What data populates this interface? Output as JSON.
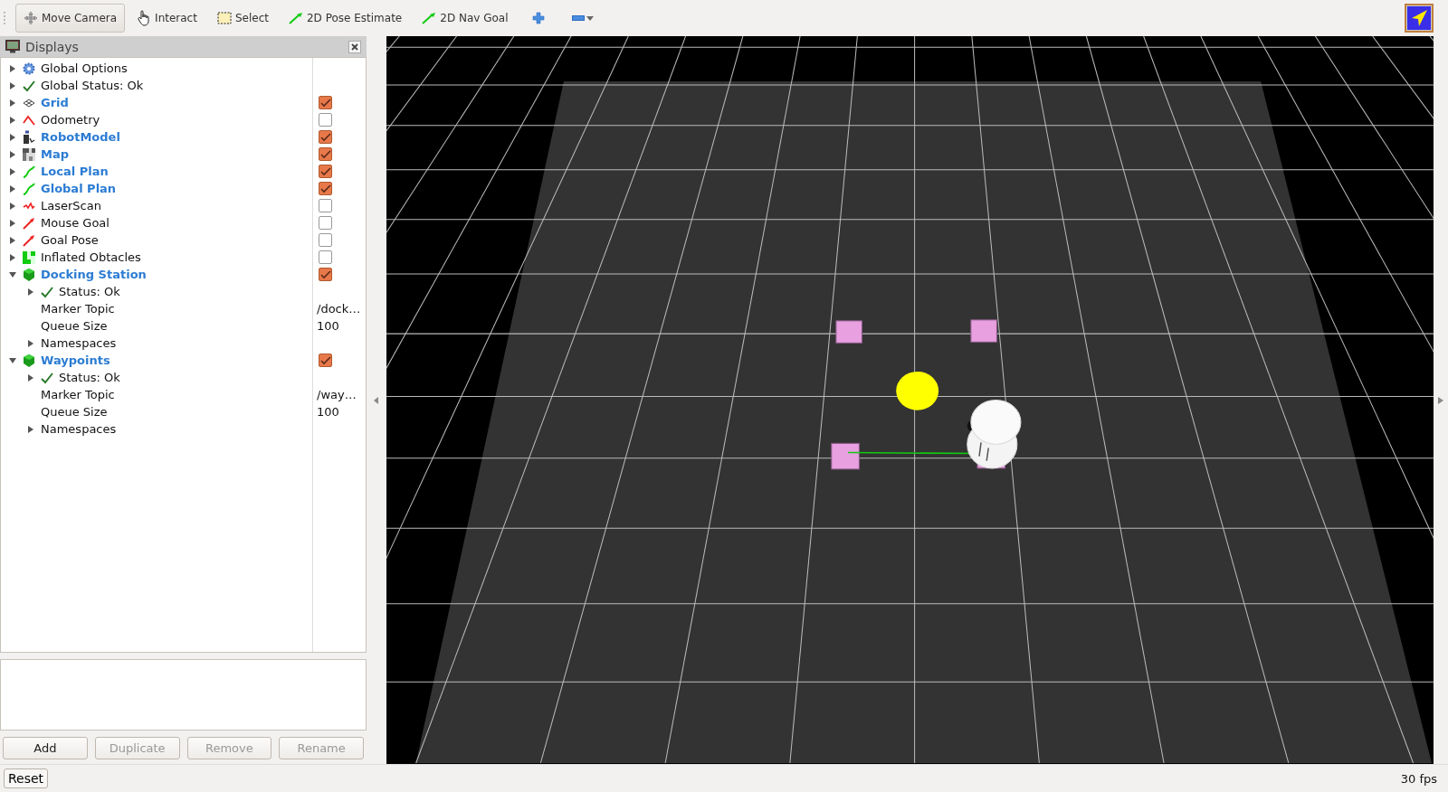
{
  "toolbar": {
    "tools": [
      {
        "kind": "move",
        "label": "Move Camera",
        "selected": true
      },
      {
        "kind": "hand",
        "label": "Interact",
        "selected": false
      },
      {
        "kind": "select",
        "label": "Select",
        "selected": false
      },
      {
        "kind": "arrow",
        "label": "2D Pose Estimate",
        "selected": false
      },
      {
        "kind": "arrow",
        "label": "2D Nav Goal",
        "selected": false
      },
      {
        "kind": "plus",
        "selected": false
      },
      {
        "kind": "minus",
        "selected": false
      }
    ]
  },
  "displays": {
    "title": "Displays",
    "items": [
      {
        "kind": "options",
        "label": "Global Options",
        "expanded": false
      },
      {
        "kind": "status",
        "label": "Global Status: Ok",
        "expanded": false
      },
      {
        "kind": "grid",
        "label": "Grid",
        "expanded": false,
        "checked": true
      },
      {
        "kind": "odometry",
        "label": "Odometry",
        "expanded": false,
        "checked": false
      },
      {
        "kind": "robot",
        "label": "RobotModel",
        "expanded": false,
        "checked": true
      },
      {
        "kind": "map",
        "label": "Map",
        "expanded": false,
        "checked": true
      },
      {
        "kind": "path",
        "label": "Local Plan",
        "expanded": false,
        "checked": true
      },
      {
        "kind": "path",
        "label": "Global Plan",
        "expanded": false,
        "checked": true
      },
      {
        "kind": "laser",
        "label": "LaserScan",
        "expanded": false,
        "checked": false
      },
      {
        "kind": "pose",
        "label": "Mouse Goal",
        "expanded": false,
        "checked": false
      },
      {
        "kind": "pose",
        "label": "Goal Pose",
        "expanded": false,
        "checked": false
      },
      {
        "kind": "cells",
        "label": "Inflated Obtacles",
        "expanded": false,
        "checked": false
      },
      {
        "kind": "marker",
        "label": "Docking Station",
        "expanded": true,
        "checked": true,
        "children": [
          {
            "kind": "status",
            "label": "Status: Ok",
            "expanded": false
          },
          {
            "kind": "property",
            "label": "Marker Topic",
            "value": "/dock…"
          },
          {
            "kind": "property",
            "label": "Queue Size",
            "value": "100"
          },
          {
            "kind": "property",
            "label": "Namespaces",
            "expanded": false
          }
        ]
      },
      {
        "kind": "marker",
        "label": "Waypoints",
        "expanded": true,
        "checked": true,
        "children": [
          {
            "kind": "status",
            "label": "Status: Ok",
            "expanded": false
          },
          {
            "kind": "property",
            "label": "Marker Topic",
            "value": "/way…"
          },
          {
            "kind": "property",
            "label": "Queue Size",
            "value": "100"
          },
          {
            "kind": "property",
            "label": "Namespaces",
            "expanded": false
          }
        ]
      }
    ]
  },
  "buttons": [
    {
      "label": "Add",
      "disabled": false
    },
    {
      "label": "Duplicate",
      "disabled": true
    },
    {
      "label": "Remove",
      "disabled": true
    },
    {
      "label": "Rename",
      "disabled": true
    }
  ],
  "status_bar": {
    "reset": "Reset",
    "fps": "30 fps"
  }
}
